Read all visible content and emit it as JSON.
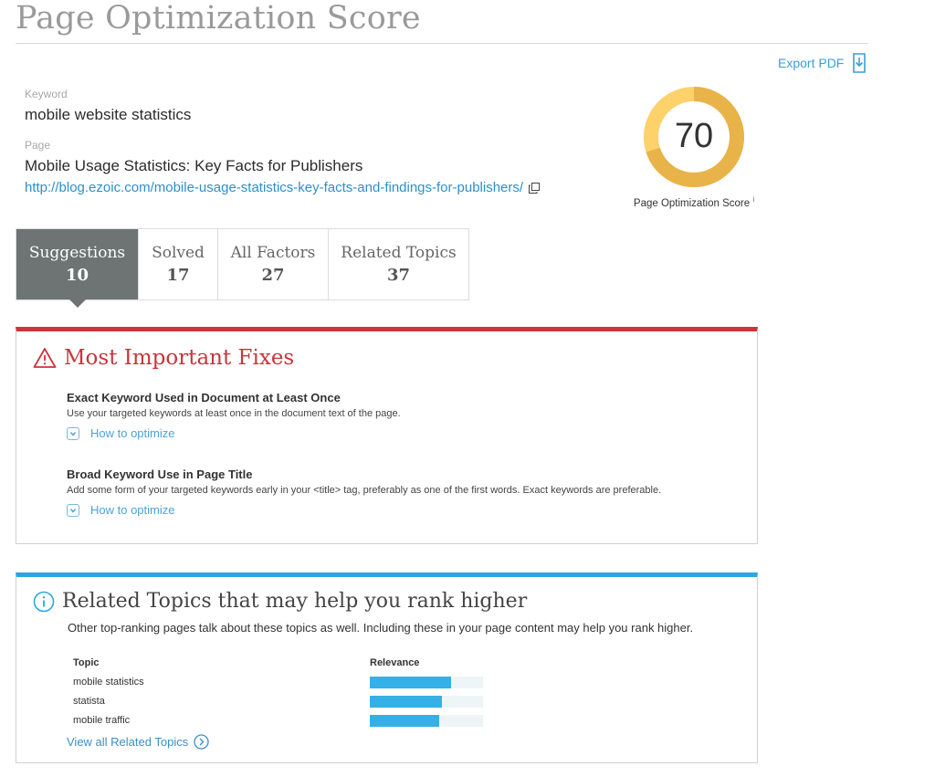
{
  "header": {
    "title": "Page Optimization Score",
    "export_label": "Export PDF"
  },
  "meta": {
    "keyword_label": "Keyword",
    "keyword": "mobile website statistics",
    "page_label": "Page",
    "page_title": "Mobile Usage Statistics: Key Facts for Publishers",
    "page_url": "http://blog.ezoic.com/mobile-usage-statistics-key-facts-and-findings-for-publishers/"
  },
  "score": {
    "value": "70",
    "fraction": 0.7,
    "caption": "Page Optimization Score",
    "info_glyph": "i",
    "track_color": "#fdd26b",
    "fill_color": "#e8b348"
  },
  "tabs": [
    {
      "label": "Suggestions",
      "count": "10",
      "active": true
    },
    {
      "label": "Solved",
      "count": "17",
      "active": false
    },
    {
      "label": "All Factors",
      "count": "27",
      "active": false
    },
    {
      "label": "Related Topics",
      "count": "37",
      "active": false
    }
  ],
  "fixes": {
    "heading": "Most Important Fixes",
    "items": [
      {
        "title": "Exact Keyword Used in Document at Least Once",
        "desc": "Use your targeted keywords at least once in the document text of the page.",
        "link": "How to optimize"
      },
      {
        "title": "Broad Keyword Use in Page Title",
        "desc": "Add some form of your targeted keywords early in your <title> tag, preferably as one of the first words. Exact keywords are preferable.",
        "link": "How to optimize"
      }
    ]
  },
  "topics": {
    "heading": "Related Topics that may help you rank higher",
    "subtitle": "Other top-ranking pages talk about these topics as well. Including these in your page content may help you rank higher.",
    "col_topic": "Topic",
    "col_relevance": "Relevance",
    "rows": [
      {
        "name": "mobile statistics",
        "relevance": 0.72
      },
      {
        "name": "statista",
        "relevance": 0.64
      },
      {
        "name": "mobile traffic",
        "relevance": 0.61
      }
    ],
    "view_all": "View all Related Topics"
  },
  "colors": {
    "accent_red": "#d0343b",
    "accent_blue": "#2aa7e0",
    "link_blue": "#3a9fd6",
    "tab_active": "#6e7474"
  }
}
